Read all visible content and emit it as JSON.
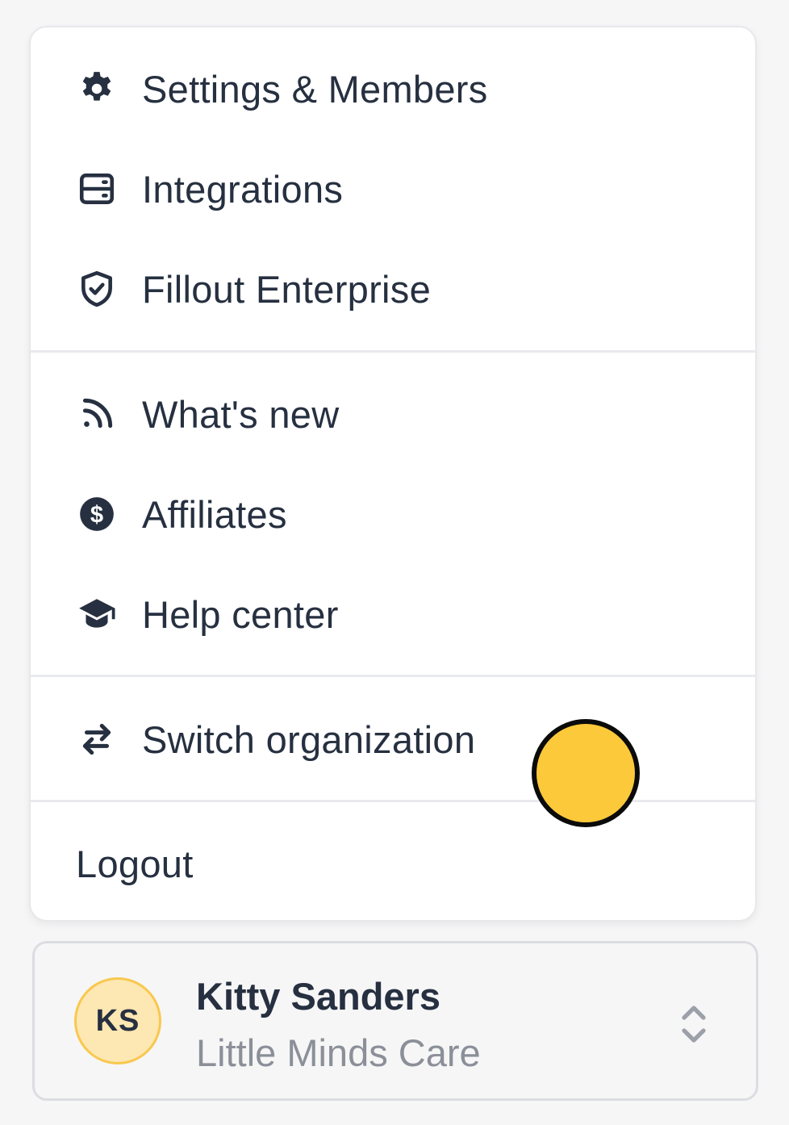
{
  "menu": {
    "group1": [
      {
        "label": "Settings & Members",
        "icon": "gear-icon"
      },
      {
        "label": "Integrations",
        "icon": "server-icon"
      },
      {
        "label": "Fillout Enterprise",
        "icon": "shield-check-icon"
      }
    ],
    "group2": [
      {
        "label": "What's new",
        "icon": "rss-icon"
      },
      {
        "label": "Affiliates",
        "icon": "dollar-circle-icon"
      },
      {
        "label": "Help center",
        "icon": "graduation-cap-icon"
      }
    ],
    "switch_org": {
      "label": "Switch organization",
      "icon": "arrows-switch-icon"
    },
    "logout": {
      "label": "Logout"
    }
  },
  "account": {
    "initials": "KS",
    "name": "Kitty Sanders",
    "organization": "Little Minds Care",
    "icon": "chevron-up-down-icon"
  },
  "colors": {
    "text": "#263040",
    "muted_text": "#8b8f98",
    "avatar_bg": "#fde7b2",
    "avatar_border": "#f8c84f",
    "cursor": "#fcc93a"
  }
}
